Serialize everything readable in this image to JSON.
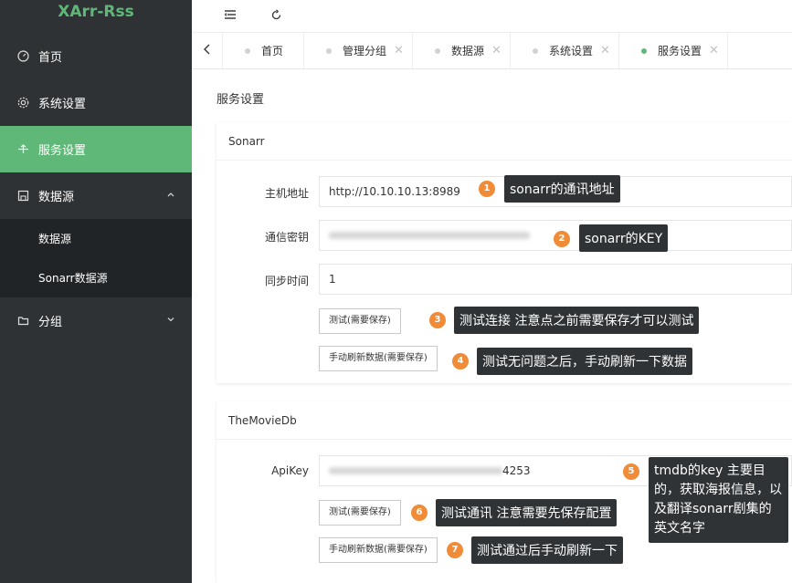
{
  "sidebar": {
    "brand": "XArr-Rss",
    "items": [
      {
        "label": "首页",
        "icon": "dashboard-icon"
      },
      {
        "label": "系统设置",
        "icon": "gear-icon"
      },
      {
        "label": "服务设置",
        "icon": "service-icon",
        "active": true
      },
      {
        "label": "数据源",
        "icon": "datasource-icon",
        "expanded": true
      },
      {
        "label": "分组",
        "icon": "folder-icon"
      }
    ],
    "subitems": [
      {
        "label": "数据源"
      },
      {
        "label": "Sonarr数据源"
      }
    ]
  },
  "tabs": [
    {
      "label": "首页",
      "closable": false
    },
    {
      "label": "管理分组",
      "closable": true
    },
    {
      "label": "数据源",
      "closable": true
    },
    {
      "label": "系统设置",
      "closable": true
    },
    {
      "label": "服务设置",
      "closable": true,
      "active": true
    }
  ],
  "main": {
    "title": "服务设置",
    "sonarr": {
      "header": "Sonarr",
      "host_label": "主机地址",
      "host_value": "http://10.10.10.13:8989",
      "key_label": "通信密钥",
      "sync_label": "同步时间",
      "sync_value": "1",
      "test_button": "测试(需要保存)",
      "refresh_button": "手动刷新数据(需要保存)"
    },
    "tmdb": {
      "header": "TheMovieDb",
      "apikey_label": "ApiKey",
      "apikey_tail": "4253",
      "test_button": "测试(需要保存)",
      "refresh_button": "手动刷新数据(需要保存)"
    }
  },
  "annotations": [
    {
      "num": "1",
      "text": "sonarr的通讯地址"
    },
    {
      "num": "2",
      "text": "sonarr的KEY"
    },
    {
      "num": "3",
      "text": "测试连接 注意点之前需要保存才可以测试"
    },
    {
      "num": "4",
      "text": "测试无问题之后，手动刷新一下数据"
    },
    {
      "num": "5",
      "text": "tmdb的key 主要目的，获取海报信息，以及翻译sonarr剧集的英文名字"
    },
    {
      "num": "6",
      "text": "测试通讯 注意需要先保存配置"
    },
    {
      "num": "7",
      "text": "测试通过后手动刷新一下"
    }
  ],
  "colors": {
    "sidebar_bg": "#2f3235",
    "accent": "#5fb878",
    "annotation_badge": "#f08c38",
    "annotation_bg": "#2f3336"
  }
}
